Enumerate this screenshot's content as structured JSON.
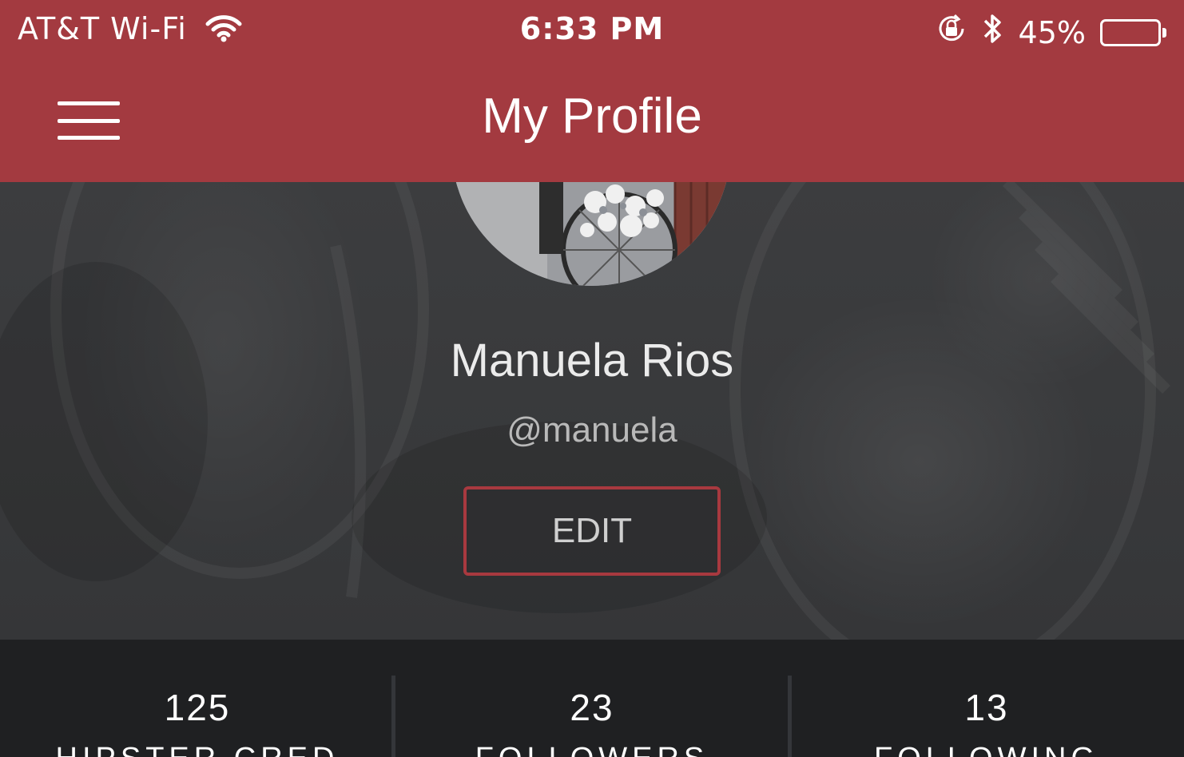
{
  "status_bar": {
    "carrier": "AT&T Wi-Fi",
    "time": "6:33 PM",
    "battery_percent": "45%",
    "battery_level": 0.45,
    "icons": [
      "wifi-icon",
      "orientation-lock-icon",
      "bluetooth-icon",
      "battery-icon"
    ]
  },
  "nav": {
    "title": "My Profile",
    "menu_icon": "hamburger-menu-icon"
  },
  "profile": {
    "name": "Manuela Rios",
    "handle": "@manuela",
    "edit_label": "EDIT"
  },
  "stats": [
    {
      "value": "125",
      "label": "HIPSTER CRED"
    },
    {
      "value": "23",
      "label": "FOLLOWERS"
    },
    {
      "value": "13",
      "label": "FOLLOWING"
    }
  ],
  "colors": {
    "header_red": "#a33a40",
    "edit_border": "#a8393f",
    "stats_background": "#1f2022"
  }
}
